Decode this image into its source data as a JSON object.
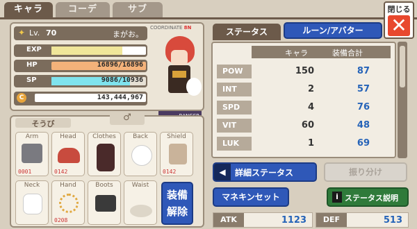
{
  "tabs": [
    "キャラ",
    "コーデ",
    "サブ"
  ],
  "close_label": "閉じる",
  "character": {
    "level_prefix": "Lv.",
    "level": "70",
    "name": "まがお。",
    "exp_label": "EXP",
    "hp_label": "HP",
    "hp_value": "16896/16896",
    "sp_label": "SP",
    "sp_value": "9086/10936",
    "gold": "143,444,967",
    "coord_label": "COORDINATE",
    "coord_num": "8N",
    "job": "RANGER",
    "exp_fill": 0.75,
    "hp_fill": 1.0,
    "sp_fill": 0.83
  },
  "equip": {
    "title": "そうび",
    "gender_symbol": "♂",
    "slots": [
      {
        "name": "Arm",
        "count": "0001"
      },
      {
        "name": "Head",
        "count": "0142"
      },
      {
        "name": "Clothes",
        "count": ""
      },
      {
        "name": "Back",
        "count": ""
      },
      {
        "name": "Shield",
        "count": "0142"
      },
      {
        "name": "Neck",
        "count": ""
      },
      {
        "name": "Hand",
        "count": "0208"
      },
      {
        "name": "Boots",
        "count": ""
      },
      {
        "name": "Waist",
        "count": ""
      }
    ],
    "equip_btn": "装備\n解除"
  },
  "status": {
    "tab_label": "ステータス",
    "rune_label": "ルーン/アバター",
    "col_chara": "キャラ",
    "col_equip": "装備合計",
    "rows": [
      {
        "label": "POW",
        "chara": "150",
        "equip": "87"
      },
      {
        "label": "INT",
        "chara": "2",
        "equip": "57"
      },
      {
        "label": "SPD",
        "chara": "4",
        "equip": "76"
      },
      {
        "label": "VIT",
        "chara": "60",
        "equip": "48"
      },
      {
        "label": "LUK",
        "chara": "1",
        "equip": "69"
      }
    ]
  },
  "buttons": {
    "detail": "詳細ステータス",
    "allocate": "振り分け",
    "mannequin": "マネキンセット",
    "status_help": "ステータス説明"
  },
  "combat": {
    "atk_label": "ATK",
    "atk": "1123",
    "def_label": "DEF",
    "def": "513"
  }
}
